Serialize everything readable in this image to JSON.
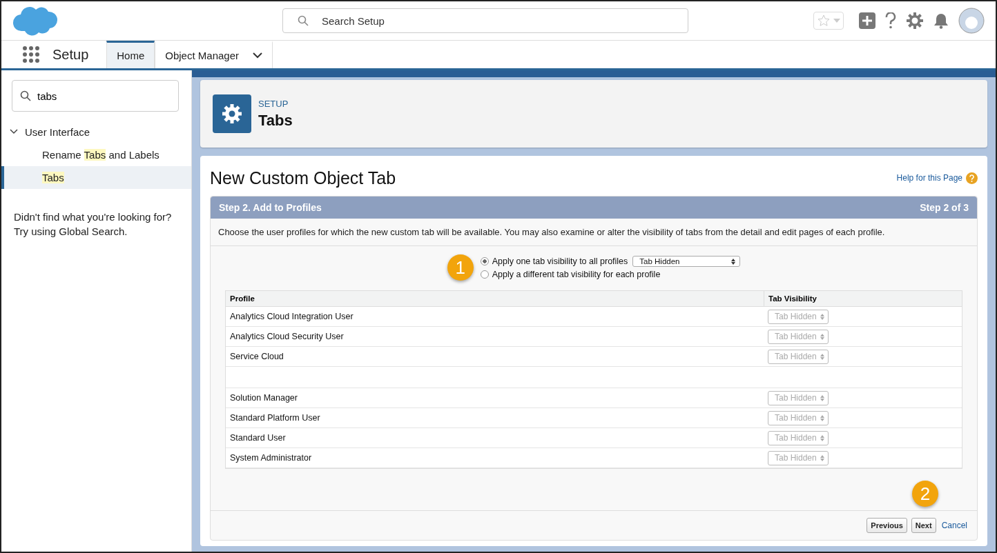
{
  "header": {
    "search": {
      "placeholder": "Search Setup"
    }
  },
  "nav": {
    "app": "Setup",
    "tabs": [
      {
        "label": "Home",
        "selected": true,
        "dropdown": false
      },
      {
        "label": "Object Manager",
        "selected": false,
        "dropdown": true
      }
    ]
  },
  "sidebar": {
    "search": {
      "value": "tabs"
    },
    "tree": [
      {
        "label": "User Interface",
        "expanded": true,
        "children": [
          {
            "label": "Rename **Tabs** and Labels",
            "selected": false
          },
          {
            "label": "**Tabs**",
            "selected": true
          }
        ]
      }
    ],
    "hint": [
      "Didn't find what you're looking for?",
      "Try using Global Search."
    ]
  },
  "page_header": {
    "eyebrow": "SETUP",
    "title": "Tabs"
  },
  "content": {
    "title": "New Custom Object Tab",
    "help_link": "Help for this Page",
    "step": {
      "title": "Step 2. Add to Profiles",
      "progress": "Step 2 of 3"
    },
    "description": "Choose the user profiles for which the new custom tab will be available. You may also examine or alter the visibility of tabs from the detail and edit pages of each profile.",
    "callouts": [
      "1",
      "2"
    ],
    "options": [
      {
        "label": "Apply one tab visibility to all profiles",
        "selected": true,
        "select_value": "Tab Hidden"
      },
      {
        "label": "Apply a different tab visibility for each profile",
        "selected": false
      }
    ],
    "table": {
      "columns": [
        "Profile",
        "Tab Visibility"
      ],
      "rows": [
        {
          "kind": "row",
          "profile": "Analytics Cloud Integration User",
          "visibility": "Tab Hidden",
          "disabled": true
        },
        {
          "kind": "row",
          "profile": "Analytics Cloud Security User",
          "visibility": "Tab Hidden",
          "disabled": true
        },
        {
          "kind": "row",
          "profile": "Service Cloud",
          "visibility": "Tab Hidden",
          "disabled": true
        },
        {
          "kind": "tear"
        },
        {
          "kind": "row",
          "profile": "Solution Manager",
          "visibility": "Tab Hidden",
          "disabled": true
        },
        {
          "kind": "row",
          "profile": "Standard Platform User",
          "visibility": "Tab Hidden",
          "disabled": true
        },
        {
          "kind": "row",
          "profile": "Standard User",
          "visibility": "Tab Hidden",
          "disabled": true
        },
        {
          "kind": "row",
          "profile": "System Administrator",
          "visibility": "Tab Hidden",
          "disabled": true
        }
      ]
    },
    "buttons": [
      {
        "kind": "button",
        "label": "Previous"
      },
      {
        "kind": "button",
        "label": "Next"
      },
      {
        "kind": "link",
        "label": "Cancel"
      }
    ]
  }
}
